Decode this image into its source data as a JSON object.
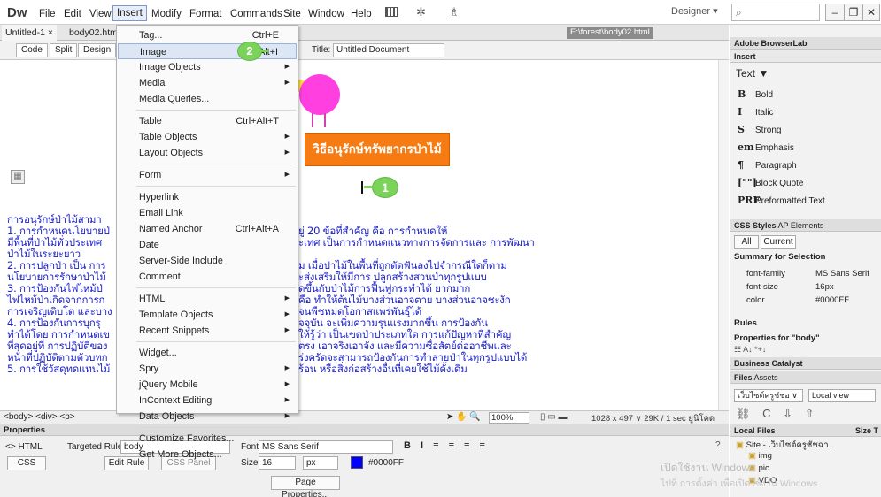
{
  "app": {
    "logo": "Dw"
  },
  "menubar": {
    "items": [
      "File",
      "Edit",
      "View",
      "Insert",
      "Modify",
      "Format",
      "Commands",
      "Site",
      "Window",
      "Help"
    ],
    "designer": "Designer"
  },
  "tabs": {
    "items": [
      "Untitled-1 ×",
      "body02.html"
    ],
    "path": "E:\\forest\\body02.html"
  },
  "toolbar": {
    "code": "Code",
    "split": "Split",
    "design": "Design",
    "title_label": "Title:",
    "title_value": "Untitled Document"
  },
  "document": {
    "banner": "วิธีอนุรักษ์ทรัพยากรป่าไม้",
    "callout1": "1",
    "lines_left": [
      "การอนุรักษ์ป่าไม้สามา",
      "1. การกำหนดนโยบายป่",
      "มีพื้นที่ป่าไม้ทั่วประเทศ",
      "ป่าไม้ในระยะยาว",
      "2. การปลูกป่า เป็น การ",
      "นโยบายการรักษาป่าไม้",
      "3. การป้องกันไฟไหม้ป่",
      "ไฟไหม้ป่าเกิดจากการก",
      "การเจริญเติบโต และบาง",
      "4. การป้องกันการบุกรุ",
      "ทำได้โดย การกำหนดเข",
      "ที่สุดอยู่ที่ การปฏิบัติของ",
      "หน้าที่ปฏิบัติตามตัวบทก",
      "5. การใช้วัสดุทดแทนไม้"
    ],
    "lines_right": [
      "ยู่ 20 ข้อที่สำคัญ คือ การกำหนดให้",
      "ะเทศ เป็นการกำหนดแนวทางการจัดการและ การพัฒนา",
      "",
      "ม เมื่อป่าไม้ในพื้นที่ถูกตัดฟันลงไปจำกรณีใดก็ตาม",
      "ะส่งเสริมให้มีการ ปลูกสร้างสวนป่าทุกรูปแบบ",
      "ดขึ้นกับป่าไม้การฟื้นฟูกระทำได้ ยากมาก",
      "คือ ทำให้ต้นไม้บางส่วนอาจตาย บางส่วนอาจชะงัก",
      "จนพืชหมดโอกาสแพร่พันธุ์ได้",
      "จจุบัน จะเพิ่มความรุนแรงมากขึ้น การป้องกัน",
      "ให้รู้ว่า เป็นเขตป่าประเภทใด การแก้ปัญหาที่สำคัญ",
      "ตรง เอาจริงเอาจัง และมีความซื่อสัตย์ต่ออาชีพและ",
      "ร่งครัดจะสามารถป้องกันการทำลายป่าในทุกรูปแบบได้",
      "ร้อน หรือสิ่งก่อสร้างอื่นที่เคยใช้ไม้ดั้งเดิม"
    ]
  },
  "statusbar": {
    "tags": "<body> <div> <p>",
    "zoom": "100%",
    "info": "1028 x 497 ∨  29K / 1 sec  ยูนิโคดไทย"
  },
  "dropdown": {
    "items": [
      {
        "label": "Tag...",
        "shortcut": "Ctrl+E",
        "arrow": false
      },
      {
        "label": "Image",
        "shortcut": "Ctrl+Alt+I",
        "arrow": false,
        "highlight": true
      },
      {
        "label": "Image Objects",
        "shortcut": "",
        "arrow": true
      },
      {
        "label": "Media",
        "shortcut": "",
        "arrow": true
      },
      {
        "label": "Media Queries...",
        "shortcut": "",
        "arrow": false
      },
      {
        "sep": true
      },
      {
        "label": "Table",
        "shortcut": "Ctrl+Alt+T",
        "arrow": false
      },
      {
        "label": "Table Objects",
        "shortcut": "",
        "arrow": true
      },
      {
        "label": "Layout Objects",
        "shortcut": "",
        "arrow": true
      },
      {
        "sep": true
      },
      {
        "label": "Form",
        "shortcut": "",
        "arrow": true
      },
      {
        "sep": true
      },
      {
        "label": "Hyperlink",
        "shortcut": "",
        "arrow": false
      },
      {
        "label": "Email Link",
        "shortcut": "",
        "arrow": false
      },
      {
        "label": "Named Anchor",
        "shortcut": "Ctrl+Alt+A",
        "arrow": false
      },
      {
        "label": "Date",
        "shortcut": "",
        "arrow": false
      },
      {
        "label": "Server-Side Include",
        "shortcut": "",
        "arrow": false
      },
      {
        "label": "Comment",
        "shortcut": "",
        "arrow": false
      },
      {
        "sep": true
      },
      {
        "label": "HTML",
        "shortcut": "",
        "arrow": true
      },
      {
        "label": "Template Objects",
        "shortcut": "",
        "arrow": true
      },
      {
        "label": "Recent Snippets",
        "shortcut": "",
        "arrow": true
      },
      {
        "sep": true
      },
      {
        "label": "Widget...",
        "shortcut": "",
        "arrow": false
      },
      {
        "label": "Spry",
        "shortcut": "",
        "arrow": true
      },
      {
        "label": "jQuery Mobile",
        "shortcut": "",
        "arrow": true
      },
      {
        "label": "InContext Editing",
        "shortcut": "",
        "arrow": true
      },
      {
        "label": "Data Objects",
        "shortcut": "",
        "arrow": true
      },
      {
        "sep": true
      },
      {
        "label": "Customize Favorites...",
        "shortcut": "",
        "arrow": false
      },
      {
        "label": "Get More Objects...",
        "shortcut": "",
        "arrow": false
      }
    ],
    "callout2": "2"
  },
  "properties": {
    "title": "Properties",
    "html": "<> HTML",
    "css": "CSS",
    "targeted_rule_label": "Targeted Rule",
    "targeted_rule": "body",
    "edit_rule": "Edit Rule",
    "css_panel": "CSS Panel",
    "font_label": "Font",
    "font_value": "MS Sans Serif",
    "size_label": "Size",
    "size_value": "16",
    "size_unit": "px",
    "color_value": "#0000FF",
    "page_props": "Page Properties..."
  },
  "right": {
    "browserlab": "Adobe BrowserLab",
    "insert": "Insert",
    "text_header": "Text ▼",
    "text_items": [
      {
        "icon": "B",
        "label": "Bold"
      },
      {
        "icon": "I",
        "label": "Italic"
      },
      {
        "icon": "S",
        "label": "Strong"
      },
      {
        "icon": "em",
        "label": "Emphasis"
      },
      {
        "icon": "¶",
        "label": "Paragraph"
      },
      {
        "icon": "[\"\"]",
        "label": "Block Quote"
      },
      {
        "icon": "PRE",
        "label": "Preformatted Text"
      }
    ],
    "css_tabs": [
      "CSS Styles",
      "AP Elements"
    ],
    "all": "All",
    "current": "Current",
    "summary": "Summary for Selection",
    "summary_rows": [
      {
        "k": "font-family",
        "v": "MS Sans Serif"
      },
      {
        "k": "font-size",
        "v": "16px"
      },
      {
        "k": "color",
        "v": "#0000FF"
      }
    ],
    "rules": "Rules",
    "props_for": "Properties for \"body\"",
    "biz": "Business Catalyst",
    "files_tabs": [
      "Files",
      "Assets"
    ],
    "site_select": "เว็บไซต์ครูชัชอ ∨",
    "view_select": "Local view",
    "local_files": "Local Files",
    "size_col": "Size T",
    "tree": [
      "Site - เว็บไซต์ครูชัชฉา...",
      "img",
      "pic",
      "VDO"
    ]
  },
  "watermark": {
    "line1": "เปิดใช้งาน Windows",
    "line2": "ไปที่ การตั้งค่า เพื่อเปิดใช้งาน Windows"
  },
  "colors": {
    "banner": "#f57b12",
    "callout": "#7bd35a",
    "text": "#1a20c8",
    "bird": "#ff3fe0",
    "highlight": "#dce6f4"
  }
}
